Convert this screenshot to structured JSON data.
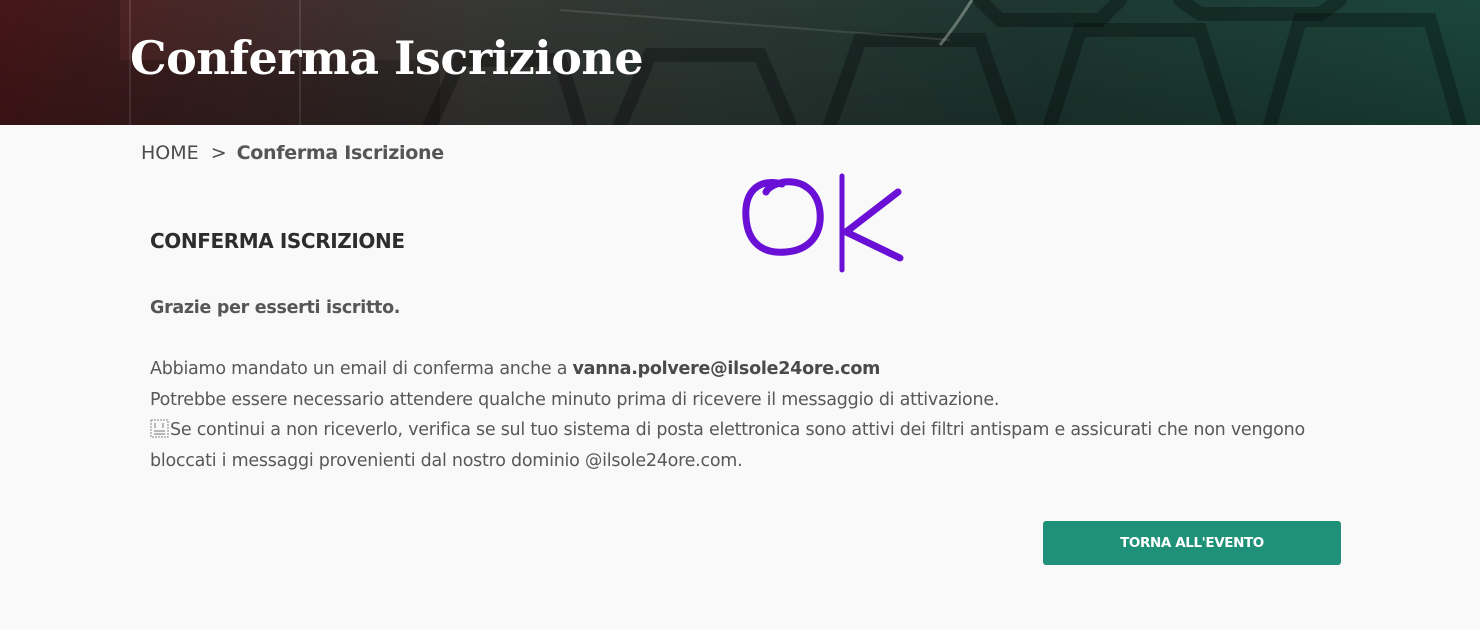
{
  "hero": {
    "title": "Conferma Iscrizione",
    "colors": {
      "left": "#5a1d20",
      "right": "#1d4a3e"
    }
  },
  "breadcrumb": {
    "home": "HOME",
    "separator": ">",
    "current": "Conferma Iscrizione"
  },
  "handwritten_mark": {
    "text": "OK",
    "color": "#6a0fd6"
  },
  "content": {
    "title": "CONFERMA ISCRIZIONE",
    "thanks": "Grazie per esserti iscritto.",
    "line1_prefix": "Abbiamo mandato un email di conferma anche a",
    "email": "vanna.polvere@ilsole24ore.com",
    "line2": "Potrebbe essere necessario attendere qualche minuto prima di ricevere il messaggio di attivazione.",
    "line3": "Se continui a non riceverlo, verifica se sul tuo sistema di posta elettronica sono attivi dei filtri antispam e assicurati che non vengono bloccati i messaggi provenienti dal nostro dominio @ilsole24ore.com."
  },
  "actions": {
    "back_label": "TORNA ALL'EVENTO",
    "back_color": "#1f9178"
  }
}
